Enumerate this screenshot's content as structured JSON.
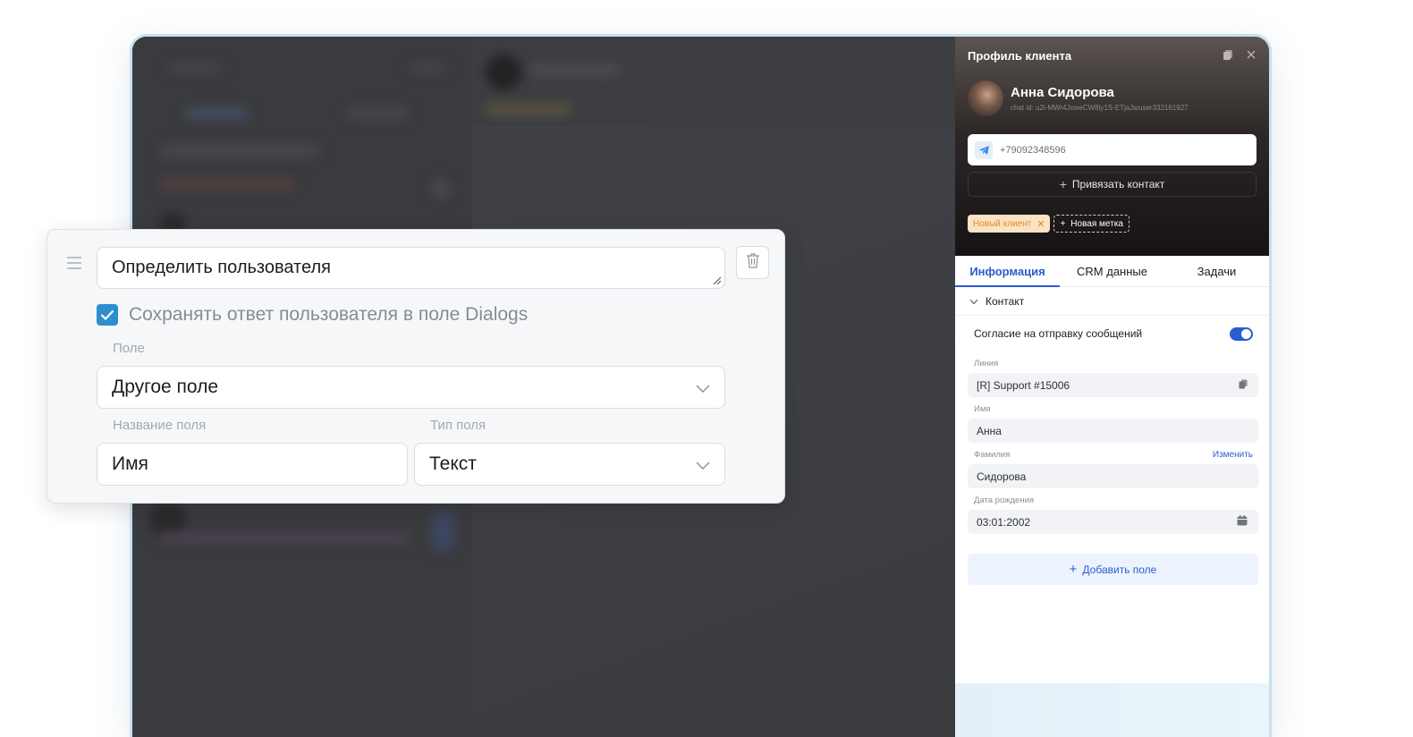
{
  "profile": {
    "title": "Профиль клиента",
    "name": "Анна Сидорова",
    "chat_id": "chat id: u2i-MWr4JxweCW8ly1S-ETjaJwuser332161927",
    "phone": "+79092348596",
    "link_contact": "Привязать контакт",
    "tags": [
      "Новый клиент"
    ],
    "new_tag": "Новая метка",
    "icons": {
      "copy": "copy-icon",
      "close": "close-icon",
      "telegram": "telegram-icon"
    }
  },
  "tabs": [
    "Информация",
    "CRM данные",
    "Задачи"
  ],
  "contact_section": {
    "title": "Контакт",
    "consent_label": "Согласие на отправку сообщений",
    "consent_enabled": true,
    "fields": {
      "line_label": "Линия",
      "line_value": "[R] Support #15006",
      "first_name_label": "Имя",
      "first_name_value": "Анна",
      "last_name_label": "Фамилия",
      "last_name_edit": "Изменить",
      "last_name_value": "Сидорова",
      "birth_label": "Дата рождения",
      "birth_value": "03:01:2002"
    },
    "add_field": "Добавить поле"
  },
  "card": {
    "main_input": "Определить пользователя",
    "save_checkbox_label": "Сохранять ответ пользователя в поле Dialogs",
    "save_checked": true,
    "field_label": "Поле",
    "field_value": "Другое поле",
    "field_name_label": "Название поля",
    "field_name_value": "Имя",
    "field_type_label": "Тип поля",
    "field_type_value": "Текст"
  },
  "colors": {
    "accent": "#2b5ccf",
    "checkbox": "#2e8fcd",
    "tag_text": "#e68a17",
    "tag_bg": "#f9e3c6"
  }
}
